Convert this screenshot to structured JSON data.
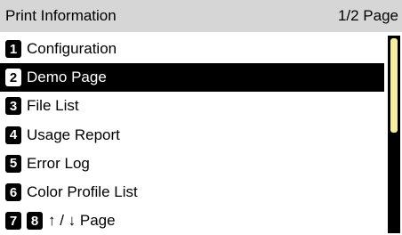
{
  "header": {
    "title": "Print Information",
    "page_indicator": "1/2 Page"
  },
  "menu": {
    "items": [
      {
        "num": "1",
        "label": "Configuration"
      },
      {
        "num": "2",
        "label": "Demo Page"
      },
      {
        "num": "3",
        "label": "File List"
      },
      {
        "num": "4",
        "label": "Usage Report"
      },
      {
        "num": "5",
        "label": "Error Log"
      },
      {
        "num": "6",
        "label": "Color Profile List"
      }
    ],
    "selected_index": 1,
    "nav": {
      "key_prev": "7",
      "key_next": "8",
      "label": "↑ / ↓ Page"
    }
  },
  "scroll": {
    "position_fraction": 0.0,
    "visible_fraction": 0.5
  },
  "colors": {
    "header_bg": "#d6d6d6",
    "selection_bg": "#000000",
    "scroll_thumb": "#f5eda2"
  }
}
